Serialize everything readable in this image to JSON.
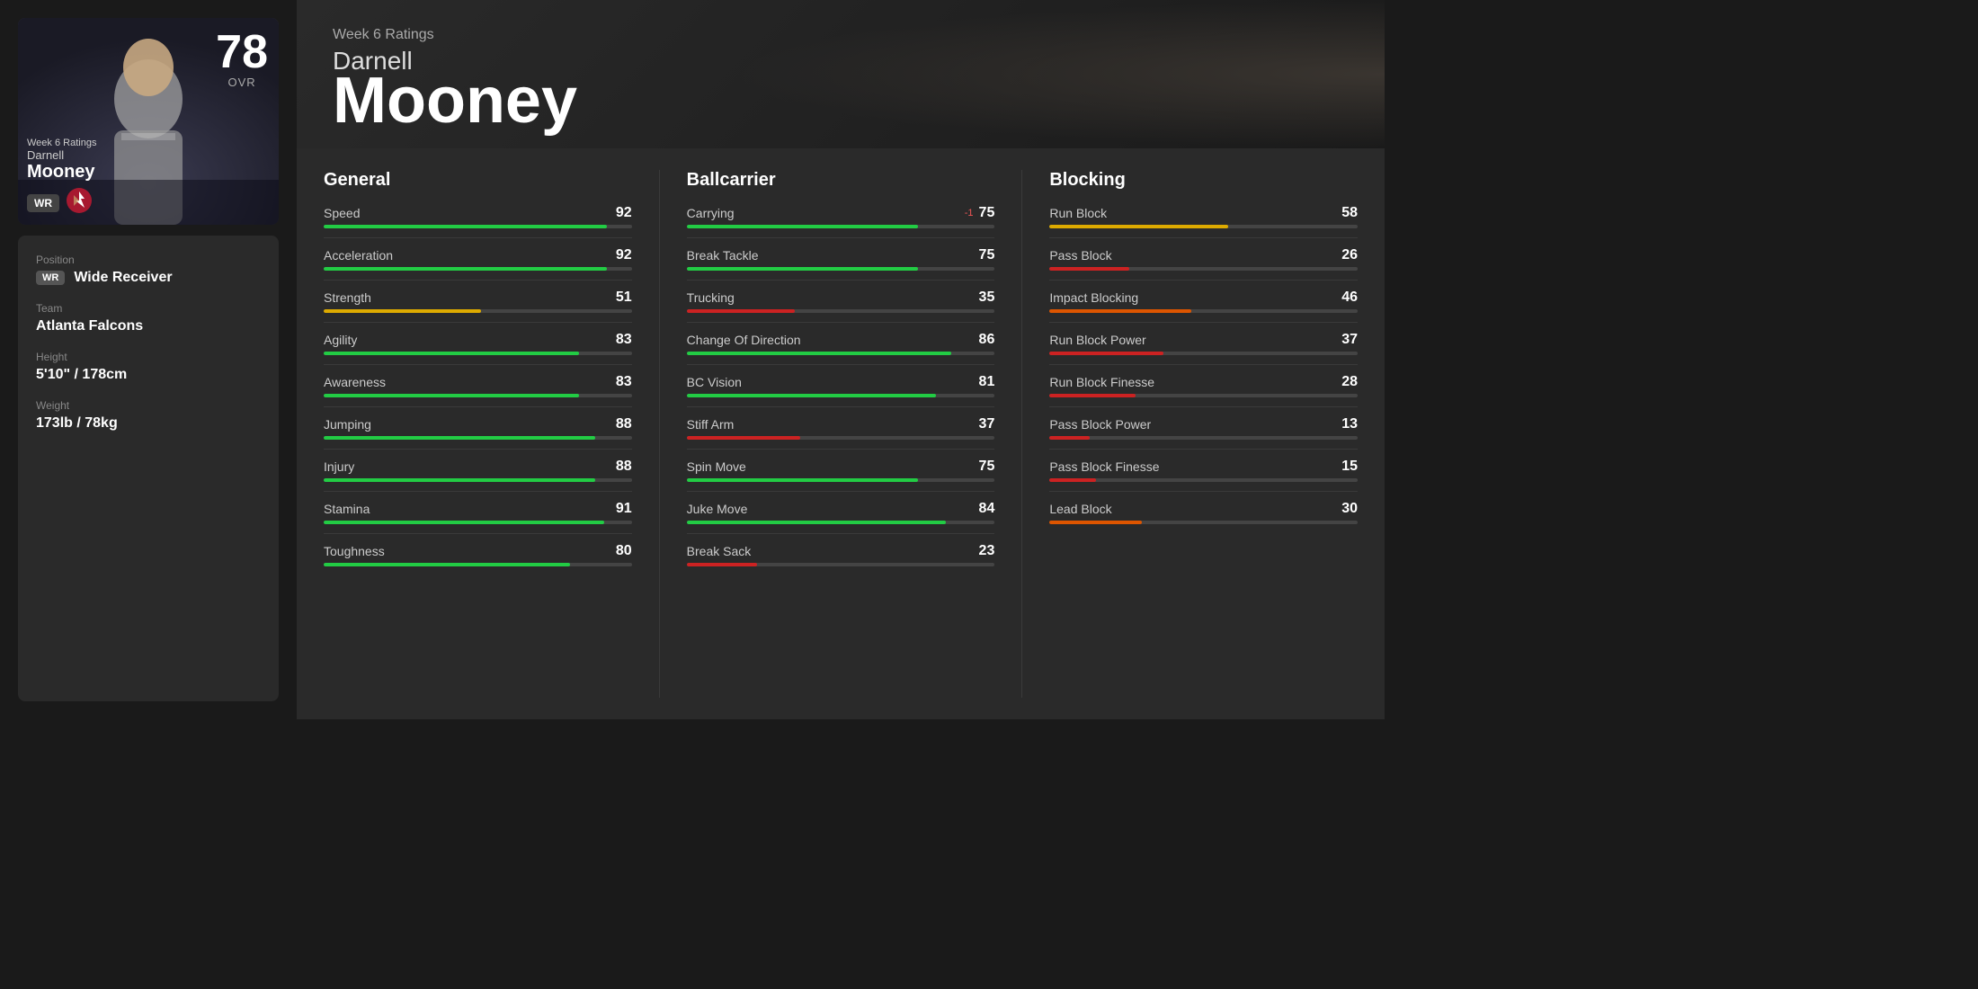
{
  "header": {
    "week_label": "Week 6 Ratings",
    "player_first": "Darnell",
    "player_last": "Mooney"
  },
  "card": {
    "ovr": "78",
    "ovr_label": "OVR",
    "week_label": "Week 6 Ratings",
    "player_first": "Darnell",
    "player_last": "Mooney",
    "position": "WR"
  },
  "info": {
    "position_label": "Position",
    "position_value": "Wide Receiver",
    "position_abbr": "WR",
    "team_label": "Team",
    "team_value": "Atlanta Falcons",
    "height_label": "Height",
    "height_value": "5'10\" / 178cm",
    "weight_label": "Weight",
    "weight_value": "173lb / 78kg"
  },
  "categories": {
    "general": {
      "title": "General",
      "stats": [
        {
          "name": "Speed",
          "value": 92,
          "color": "green"
        },
        {
          "name": "Acceleration",
          "value": 92,
          "color": "green"
        },
        {
          "name": "Strength",
          "value": 51,
          "color": "yellow"
        },
        {
          "name": "Agility",
          "value": 83,
          "color": "green"
        },
        {
          "name": "Awareness",
          "value": 83,
          "color": "green"
        },
        {
          "name": "Jumping",
          "value": 88,
          "color": "green"
        },
        {
          "name": "Injury",
          "value": 88,
          "color": "green"
        },
        {
          "name": "Stamina",
          "value": 91,
          "color": "green"
        },
        {
          "name": "Toughness",
          "value": 80,
          "color": "green"
        }
      ]
    },
    "ballcarrier": {
      "title": "Ballcarrier",
      "stats": [
        {
          "name": "Carrying",
          "value": 75,
          "color": "green",
          "delta": "-1"
        },
        {
          "name": "Break Tackle",
          "value": 75,
          "color": "green"
        },
        {
          "name": "Trucking",
          "value": 35,
          "color": "red"
        },
        {
          "name": "Change Of Direction",
          "value": 86,
          "color": "green"
        },
        {
          "name": "BC Vision",
          "value": 81,
          "color": "green"
        },
        {
          "name": "Stiff Arm",
          "value": 37,
          "color": "red"
        },
        {
          "name": "Spin Move",
          "value": 75,
          "color": "green"
        },
        {
          "name": "Juke Move",
          "value": 84,
          "color": "green"
        },
        {
          "name": "Break Sack",
          "value": 23,
          "color": "red"
        }
      ]
    },
    "blocking": {
      "title": "Blocking",
      "stats": [
        {
          "name": "Run Block",
          "value": 58,
          "color": "yellow"
        },
        {
          "name": "Pass Block",
          "value": 26,
          "color": "red"
        },
        {
          "name": "Impact Blocking",
          "value": 46,
          "color": "orange"
        },
        {
          "name": "Run Block Power",
          "value": 37,
          "color": "red"
        },
        {
          "name": "Run Block Finesse",
          "value": 28,
          "color": "red"
        },
        {
          "name": "Pass Block Power",
          "value": 13,
          "color": "red"
        },
        {
          "name": "Pass Block Finesse",
          "value": 15,
          "color": "red"
        },
        {
          "name": "Lead Block",
          "value": 30,
          "color": "orange"
        }
      ]
    }
  }
}
